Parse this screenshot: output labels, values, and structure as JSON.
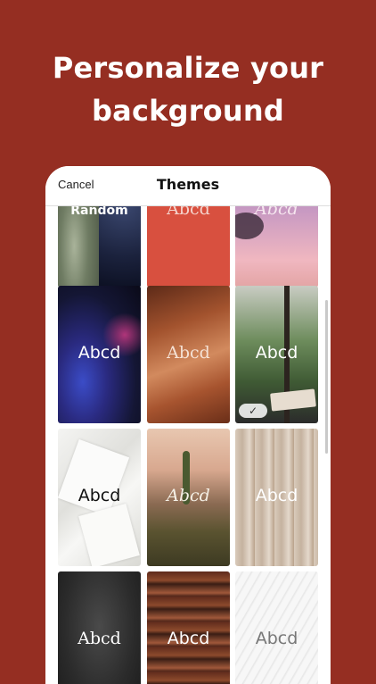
{
  "headline": {
    "line1": "Personalize your",
    "line2": "background"
  },
  "navbar": {
    "cancel_label": "Cancel",
    "title": "Themes"
  },
  "tiles": [
    {
      "label": "Random"
    },
    {
      "label": "Abcd"
    },
    {
      "label": "Abcd"
    },
    {
      "label": "Abcd"
    },
    {
      "label": "Abcd"
    },
    {
      "label": "Abcd",
      "selected_icon": "check-icon",
      "selected_glyph": "✓"
    },
    {
      "label": "Abcd"
    },
    {
      "label": "Abcd"
    },
    {
      "label": "Abcd"
    },
    {
      "label": "Abcd"
    },
    {
      "label": "Abcd"
    },
    {
      "label": "Abcd"
    }
  ],
  "colors": {
    "brand_background": "#952e22",
    "coral_tile": "#d8503f"
  }
}
